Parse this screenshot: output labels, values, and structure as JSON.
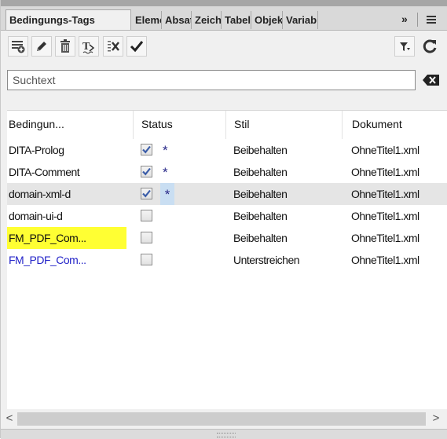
{
  "tabs": [
    {
      "label": "Bedingungs-Tags",
      "active": true
    },
    {
      "label": "Eleme"
    },
    {
      "label": "Absat"
    },
    {
      "label": "Zeich"
    },
    {
      "label": "Tabel"
    },
    {
      "label": "Objek"
    },
    {
      "label": "Variab"
    }
  ],
  "tab_overflow": {
    "more_label": "»",
    "menu_icon": "hamburger-menu-icon"
  },
  "toolbar": {
    "icons": [
      "new-condition-icon",
      "edit-pencil-icon",
      "delete-trash-icon",
      "show-tags-icon",
      "remove-condition-icon",
      "apply-checkmark-icon",
      "filter-icon",
      "refresh-icon"
    ]
  },
  "search": {
    "placeholder": "Suchtext",
    "value": "",
    "clear_icon": "clear-backspace-icon"
  },
  "table": {
    "headers": [
      "Bedingun...",
      "Status",
      "Stil",
      "Dokument"
    ],
    "rows": [
      {
        "name": "DITA-Prolog",
        "checked": true,
        "marker": "*",
        "style": "Beibehalten",
        "document": "OhneTitel1.xml",
        "name_color": "#111111",
        "highlight": ""
      },
      {
        "name": "DITA-Comment",
        "checked": true,
        "marker": "*",
        "style": "Beibehalten",
        "document": "OhneTitel1.xml",
        "name_color": "#111111",
        "highlight": ""
      },
      {
        "name": "domain-xml-d",
        "checked": true,
        "marker": "*",
        "style": "Beibehalten",
        "document": "OhneTitel1.xml",
        "name_color": "#111111",
        "highlight": "",
        "selected": true
      },
      {
        "name": "domain-ui-d",
        "checked": false,
        "marker": "",
        "style": "Beibehalten",
        "document": "OhneTitel1.xml",
        "name_color": "#111111",
        "highlight": ""
      },
      {
        "name": "FM_PDF_Com...",
        "checked": false,
        "marker": "",
        "style": "Beibehalten",
        "document": "OhneTitel1.xml",
        "name_color": "#111111",
        "highlight": "#ffff33"
      },
      {
        "name": "FM_PDF_Com...",
        "checked": false,
        "marker": "",
        "style": "Unterstreichen",
        "document": "OhneTitel1.xml",
        "name_color": "#2323c8",
        "highlight": ""
      }
    ]
  },
  "scrollbar": {
    "left_arrow": "<",
    "right_arrow": ">"
  },
  "colors": {
    "selected_row": "#e5e5e5",
    "star_highlight": "#c9def2",
    "check": "#3b5da8"
  }
}
